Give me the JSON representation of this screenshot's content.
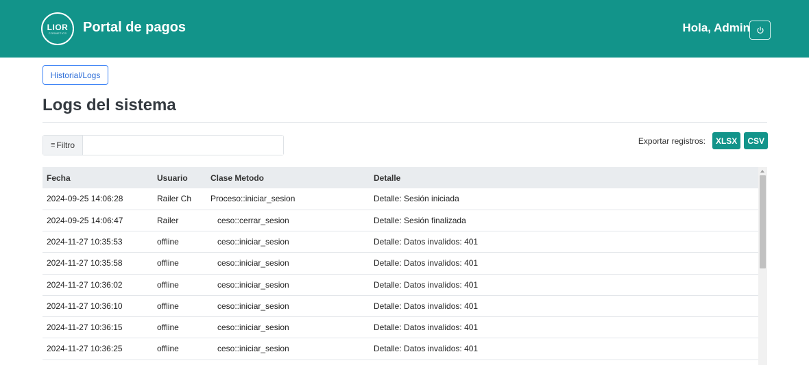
{
  "header": {
    "logo_text": "LIOR",
    "logo_sub": "COSMETICS",
    "title": "Portal de pagos",
    "greeting": "Hola, Admin"
  },
  "breadcrumb": {
    "label": "Historial/Logs"
  },
  "page_title": "Logs del sistema",
  "filter": {
    "label": "Filtro",
    "value": ""
  },
  "export": {
    "label": "Exportar registros:",
    "xlsx": "XLSX",
    "csv": "CSV"
  },
  "colors": {
    "primary": "#12948a",
    "link": "#2f6fd8"
  },
  "table": {
    "headers": [
      "Fecha",
      "Usuario",
      "Clase Metodo",
      "Detalle"
    ],
    "rows": [
      [
        "2024-09-25 14:06:28",
        "Railer Ch",
        "Proceso::iniciar_sesion",
        "Detalle: Sesión iniciada"
      ],
      [
        "2024-09-25 14:06:47",
        "Railer",
        "ceso::cerrar_sesion",
        "Detalle: Sesión finalizada"
      ],
      [
        "2024-11-27 10:35:53",
        "offline",
        "ceso::iniciar_sesion",
        "Detalle: Datos invalidos: 401"
      ],
      [
        "2024-11-27 10:35:58",
        "offline",
        "ceso::iniciar_sesion",
        "Detalle: Datos invalidos: 401"
      ],
      [
        "2024-11-27 10:36:02",
        "offline",
        "ceso::iniciar_sesion",
        "Detalle: Datos invalidos: 401"
      ],
      [
        "2024-11-27 10:36:10",
        "offline",
        "ceso::iniciar_sesion",
        "Detalle: Datos invalidos: 401"
      ],
      [
        "2024-11-27 10:36:15",
        "offline",
        "ceso::iniciar_sesion",
        "Detalle: Datos invalidos: 401"
      ],
      [
        "2024-11-27 10:36:25",
        "offline",
        "ceso::iniciar_sesion",
        "Detalle: Datos invalidos: 401"
      ]
    ]
  }
}
